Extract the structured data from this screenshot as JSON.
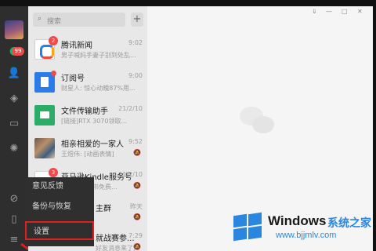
{
  "sidebar": {
    "unread_count": "99",
    "icons": [
      "avatar",
      "chat-icon",
      "contacts-icon",
      "cube-icon",
      "folder-icon",
      "moments-icon",
      "mini-program-icon",
      "phone-icon",
      "menu-icon"
    ]
  },
  "search": {
    "placeholder": "搜索"
  },
  "conversations": [
    {
      "name": "腾讯新闻",
      "preview": "男子喊妈手妻子别到处乱...",
      "time": "9:02",
      "badge": "2"
    },
    {
      "name": "订阅号",
      "preview": "财星人: 惊心动魄87%用...",
      "time": "9:00"
    },
    {
      "name": "文件传输助手",
      "preview": "[链接]RTX 3070领取...",
      "time": "21/2/10"
    },
    {
      "name": "相亲相爱的一家人",
      "preview": "王煜伟: [动画表情]",
      "time": "9:52"
    },
    {
      "name": "亚马逊Kindle服务号",
      "preview": "亚马逊电子书免费...",
      "time": "21/2/10",
      "badge": "3"
    },
    {
      "name": "主群",
      "preview": "",
      "time": "昨天"
    },
    {
      "name": "就战赛参...",
      "preview": "好友消息来了, 需要...",
      "time": "7:29"
    }
  ],
  "menu": {
    "items": [
      "意见反馈",
      "备份与恢复",
      "设置"
    ],
    "selected": "设置"
  },
  "watermark": {
    "brand": "Windows",
    "cn": "系统之家",
    "url": "www.bjjmlv.com"
  },
  "colors": {
    "accent": "#07c160",
    "highlight": "#e02020",
    "badge": "#f04b4b"
  }
}
